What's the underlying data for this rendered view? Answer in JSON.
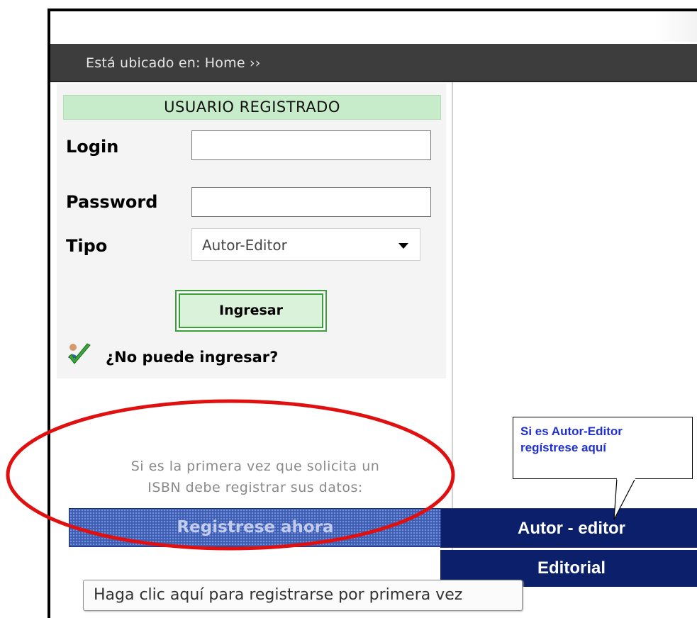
{
  "breadcrumb": {
    "label": "Está ubicado en: Home ››"
  },
  "login_panel": {
    "title": "USUARIO REGISTRADO",
    "login_label": "Login",
    "login_value": "",
    "password_label": "Password",
    "password_value": "",
    "tipo_label": "Tipo",
    "tipo_selected": "Autor-Editor",
    "submit_label": "Ingresar",
    "forgot_label": "¿No puede ingresar?"
  },
  "register": {
    "hint_line1": "Si es la primera vez que solicita un",
    "hint_line2": "ISBN debe registrar sus datos:",
    "button_label": "Registrese ahora",
    "tooltip": "Haga clic aquí para registrarse por primera vez"
  },
  "nav": {
    "autor_editor": "Autor - editor",
    "editorial": "Editorial"
  },
  "callout": {
    "line1": "Si es Autor-Editor",
    "line2": "regístrese aquí"
  },
  "colors": {
    "breadcrumb_bg": "#3d3d3d",
    "panel_header_bg": "#c6ecc9",
    "nav_bg": "#0b1f6a",
    "register_bg": "#3d5fb6",
    "callout_text": "#1f2fd6",
    "annotation_circle": "#e01010"
  }
}
